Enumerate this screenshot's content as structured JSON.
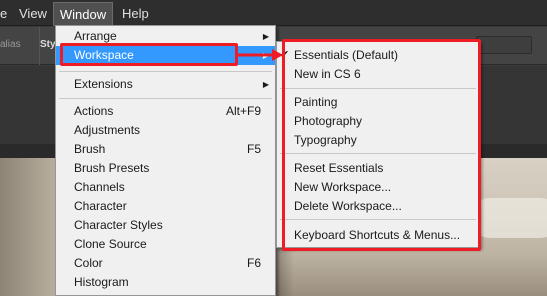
{
  "menubar": {
    "edge_fragment": "e",
    "items": [
      "View",
      "Window",
      "Help"
    ]
  },
  "options_bar": {
    "fragment_left": "alias",
    "fragment_style": "Sty"
  },
  "window_menu": {
    "items": [
      {
        "label": "Arrange",
        "submenu": true
      },
      {
        "label": "Workspace",
        "submenu": true,
        "highlighted": true
      },
      {
        "label": "Extensions",
        "submenu": true
      },
      {
        "label": "Actions",
        "shortcut": "Alt+F9"
      },
      {
        "label": "Adjustments"
      },
      {
        "label": "Brush",
        "shortcut": "F5"
      },
      {
        "label": "Brush Presets"
      },
      {
        "label": "Channels"
      },
      {
        "label": "Character"
      },
      {
        "label": "Character Styles"
      },
      {
        "label": "Clone Source"
      },
      {
        "label": "Color",
        "shortcut": "F6"
      },
      {
        "label": "Histogram"
      }
    ]
  },
  "workspace_menu": {
    "items": [
      {
        "label": "Essentials (Default)",
        "checked": true
      },
      {
        "label": "New in CS 6"
      },
      {
        "label": "Painting"
      },
      {
        "label": "Photography"
      },
      {
        "label": "Typography"
      },
      {
        "label": "Reset Essentials"
      },
      {
        "label": "New Workspace..."
      },
      {
        "label": "Delete Workspace..."
      },
      {
        "label": "Keyboard Shortcuts & Menus..."
      }
    ]
  },
  "icons": {
    "submenu_arrow": "triangle-right-icon",
    "checkmark": "checkmark-icon",
    "annotation_arrow": "red-arrow-icon"
  },
  "colors": {
    "highlight": "#3399ff",
    "annotation": "#ee1c25",
    "menu_bg": "#f0f0f0",
    "menubar_bg": "#2e2e2e"
  }
}
